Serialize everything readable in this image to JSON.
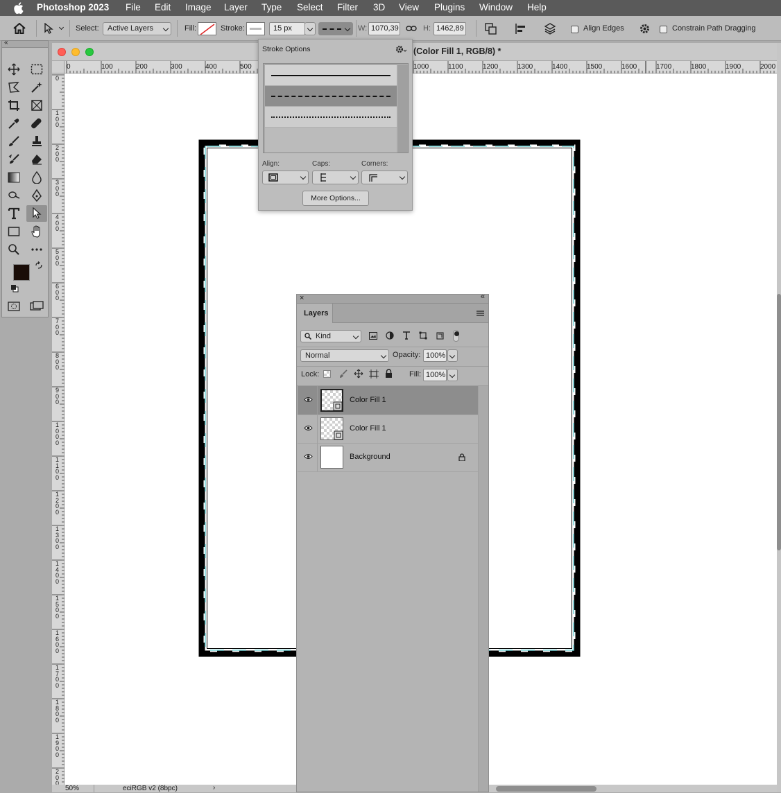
{
  "menubar": {
    "app_name": "Photoshop 2023",
    "items": [
      "File",
      "Edit",
      "Image",
      "Layer",
      "Type",
      "Select",
      "Filter",
      "3D",
      "View",
      "Plugins",
      "Window",
      "Help"
    ]
  },
  "options_bar": {
    "select_label": "Select:",
    "select_value": "Active Layers",
    "fill_label": "Fill:",
    "stroke_label": "Stroke:",
    "stroke_width": "15 px",
    "w_label": "W:",
    "w_value": "1070,39",
    "h_label": "H:",
    "h_value": "1462,89",
    "align_edges_label": "Align Edges",
    "constrain_label": "Constrain Path Dragging"
  },
  "document": {
    "title": "(Color Fill 1, RGB/8) *",
    "h_ruler_labels": [
      "0",
      "100",
      "200",
      "300",
      "400",
      "500",
      "1000",
      "1100",
      "1200",
      "1300",
      "1400",
      "1500",
      "1600",
      "1700",
      "1800",
      "1900",
      "2000"
    ],
    "v_ruler_labels": [
      "0",
      "100",
      "200",
      "300",
      "400",
      "500",
      "600",
      "700",
      "800",
      "900",
      "1000",
      "1100",
      "1200",
      "1300",
      "1400",
      "1500",
      "1600",
      "1700",
      "1800",
      "1900",
      "2000"
    ],
    "zoom": "50%",
    "color_profile": "eciRGB v2 (8bpc)"
  },
  "stroke_options": {
    "title": "Stroke Options",
    "align_label": "Align:",
    "caps_label": "Caps:",
    "corners_label": "Corners:",
    "more_options": "More Options..."
  },
  "layers_panel": {
    "tab": "Layers",
    "kind_label": "Kind",
    "blend_mode": "Normal",
    "opacity_label": "Opacity:",
    "opacity_value": "100%",
    "lock_label": "Lock:",
    "fill_label": "Fill:",
    "fill_value": "100%",
    "layers": [
      {
        "name": "Color Fill 1",
        "selected": true
      },
      {
        "name": "Color Fill 1",
        "selected": false
      },
      {
        "name": "Background",
        "selected": false
      }
    ]
  },
  "colors": {
    "stroke_black": "#000000",
    "stroke_dash_accent": "#7fd8dc",
    "foreground": "#1a0d08",
    "background": "#ffffff",
    "selected_layer": "#8d8d8d"
  }
}
